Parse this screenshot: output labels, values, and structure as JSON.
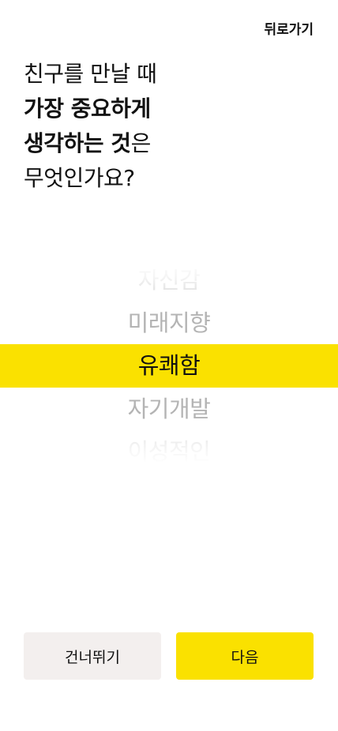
{
  "header": {
    "back_label": "뒤로가기"
  },
  "question": {
    "line1": "친구를 만날 때",
    "line2": "가장 중요하게",
    "line3_strong": "생각하는 것",
    "line3_rest": "은",
    "line4": "무엇인가요?"
  },
  "picker": {
    "options": [
      "자신감",
      "미래지향",
      "유쾌함",
      "자기개발",
      "이성적인"
    ],
    "selected": "유쾌함"
  },
  "buttons": {
    "skip_label": "건너뛰기",
    "next_label": "다음"
  },
  "colors": {
    "accent": "#fae100",
    "secondary_button": "#f3efee",
    "text": "#111111",
    "muted_text": "#b4b4b4"
  }
}
